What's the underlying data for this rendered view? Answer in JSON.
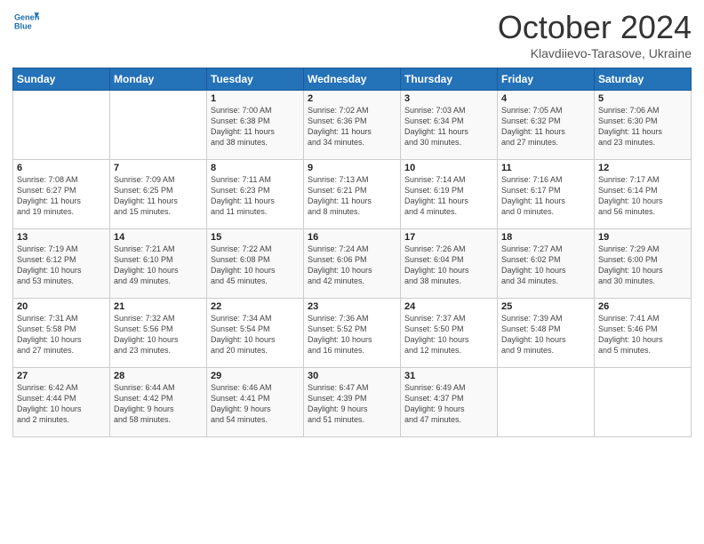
{
  "header": {
    "logo_line1": "General",
    "logo_line2": "Blue",
    "month": "October 2024",
    "location": "Klavdiievo-Tarasove, Ukraine"
  },
  "weekdays": [
    "Sunday",
    "Monday",
    "Tuesday",
    "Wednesday",
    "Thursday",
    "Friday",
    "Saturday"
  ],
  "weeks": [
    [
      {
        "day": "",
        "text": ""
      },
      {
        "day": "",
        "text": ""
      },
      {
        "day": "1",
        "text": "Sunrise: 7:00 AM\nSunset: 6:38 PM\nDaylight: 11 hours\nand 38 minutes."
      },
      {
        "day": "2",
        "text": "Sunrise: 7:02 AM\nSunset: 6:36 PM\nDaylight: 11 hours\nand 34 minutes."
      },
      {
        "day": "3",
        "text": "Sunrise: 7:03 AM\nSunset: 6:34 PM\nDaylight: 11 hours\nand 30 minutes."
      },
      {
        "day": "4",
        "text": "Sunrise: 7:05 AM\nSunset: 6:32 PM\nDaylight: 11 hours\nand 27 minutes."
      },
      {
        "day": "5",
        "text": "Sunrise: 7:06 AM\nSunset: 6:30 PM\nDaylight: 11 hours\nand 23 minutes."
      }
    ],
    [
      {
        "day": "6",
        "text": "Sunrise: 7:08 AM\nSunset: 6:27 PM\nDaylight: 11 hours\nand 19 minutes."
      },
      {
        "day": "7",
        "text": "Sunrise: 7:09 AM\nSunset: 6:25 PM\nDaylight: 11 hours\nand 15 minutes."
      },
      {
        "day": "8",
        "text": "Sunrise: 7:11 AM\nSunset: 6:23 PM\nDaylight: 11 hours\nand 11 minutes."
      },
      {
        "day": "9",
        "text": "Sunrise: 7:13 AM\nSunset: 6:21 PM\nDaylight: 11 hours\nand 8 minutes."
      },
      {
        "day": "10",
        "text": "Sunrise: 7:14 AM\nSunset: 6:19 PM\nDaylight: 11 hours\nand 4 minutes."
      },
      {
        "day": "11",
        "text": "Sunrise: 7:16 AM\nSunset: 6:17 PM\nDaylight: 11 hours\nand 0 minutes."
      },
      {
        "day": "12",
        "text": "Sunrise: 7:17 AM\nSunset: 6:14 PM\nDaylight: 10 hours\nand 56 minutes."
      }
    ],
    [
      {
        "day": "13",
        "text": "Sunrise: 7:19 AM\nSunset: 6:12 PM\nDaylight: 10 hours\nand 53 minutes."
      },
      {
        "day": "14",
        "text": "Sunrise: 7:21 AM\nSunset: 6:10 PM\nDaylight: 10 hours\nand 49 minutes."
      },
      {
        "day": "15",
        "text": "Sunrise: 7:22 AM\nSunset: 6:08 PM\nDaylight: 10 hours\nand 45 minutes."
      },
      {
        "day": "16",
        "text": "Sunrise: 7:24 AM\nSunset: 6:06 PM\nDaylight: 10 hours\nand 42 minutes."
      },
      {
        "day": "17",
        "text": "Sunrise: 7:26 AM\nSunset: 6:04 PM\nDaylight: 10 hours\nand 38 minutes."
      },
      {
        "day": "18",
        "text": "Sunrise: 7:27 AM\nSunset: 6:02 PM\nDaylight: 10 hours\nand 34 minutes."
      },
      {
        "day": "19",
        "text": "Sunrise: 7:29 AM\nSunset: 6:00 PM\nDaylight: 10 hours\nand 30 minutes."
      }
    ],
    [
      {
        "day": "20",
        "text": "Sunrise: 7:31 AM\nSunset: 5:58 PM\nDaylight: 10 hours\nand 27 minutes."
      },
      {
        "day": "21",
        "text": "Sunrise: 7:32 AM\nSunset: 5:56 PM\nDaylight: 10 hours\nand 23 minutes."
      },
      {
        "day": "22",
        "text": "Sunrise: 7:34 AM\nSunset: 5:54 PM\nDaylight: 10 hours\nand 20 minutes."
      },
      {
        "day": "23",
        "text": "Sunrise: 7:36 AM\nSunset: 5:52 PM\nDaylight: 10 hours\nand 16 minutes."
      },
      {
        "day": "24",
        "text": "Sunrise: 7:37 AM\nSunset: 5:50 PM\nDaylight: 10 hours\nand 12 minutes."
      },
      {
        "day": "25",
        "text": "Sunrise: 7:39 AM\nSunset: 5:48 PM\nDaylight: 10 hours\nand 9 minutes."
      },
      {
        "day": "26",
        "text": "Sunrise: 7:41 AM\nSunset: 5:46 PM\nDaylight: 10 hours\nand 5 minutes."
      }
    ],
    [
      {
        "day": "27",
        "text": "Sunrise: 6:42 AM\nSunset: 4:44 PM\nDaylight: 10 hours\nand 2 minutes."
      },
      {
        "day": "28",
        "text": "Sunrise: 6:44 AM\nSunset: 4:42 PM\nDaylight: 9 hours\nand 58 minutes."
      },
      {
        "day": "29",
        "text": "Sunrise: 6:46 AM\nSunset: 4:41 PM\nDaylight: 9 hours\nand 54 minutes."
      },
      {
        "day": "30",
        "text": "Sunrise: 6:47 AM\nSunset: 4:39 PM\nDaylight: 9 hours\nand 51 minutes."
      },
      {
        "day": "31",
        "text": "Sunrise: 6:49 AM\nSunset: 4:37 PM\nDaylight: 9 hours\nand 47 minutes."
      },
      {
        "day": "",
        "text": ""
      },
      {
        "day": "",
        "text": ""
      }
    ]
  ]
}
